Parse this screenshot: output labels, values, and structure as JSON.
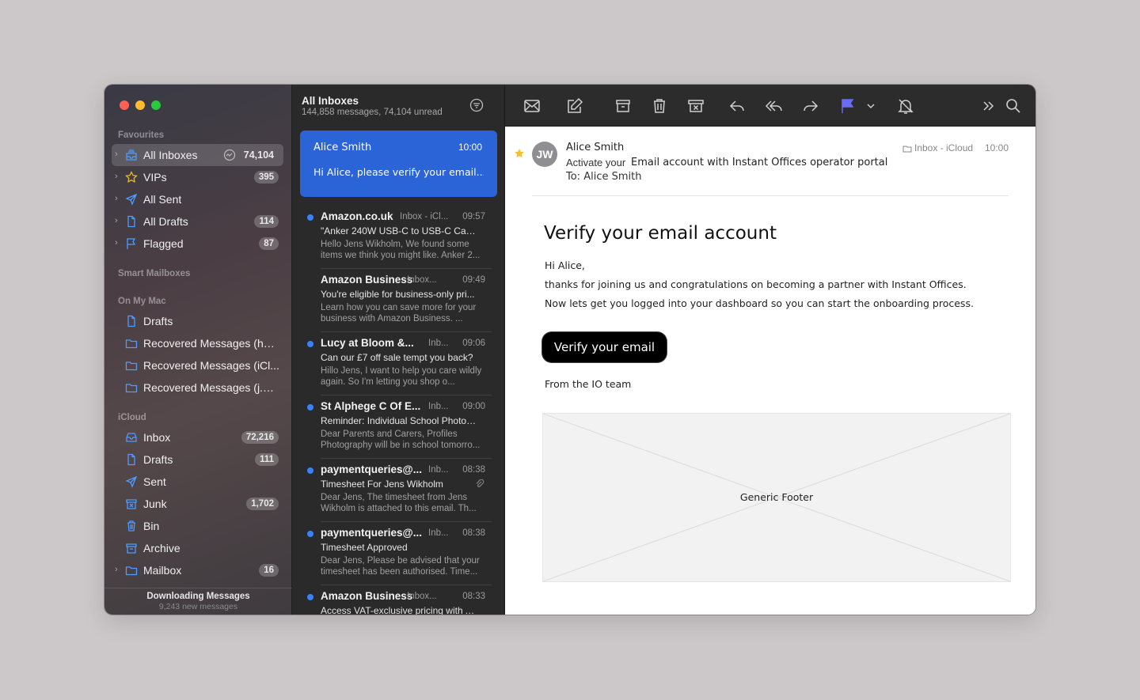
{
  "sidebar": {
    "sections": {
      "favourites": "Favourites",
      "smart": "Smart Mailboxes",
      "mac": "On My Mac",
      "icloud": "iCloud"
    },
    "favourites": [
      {
        "label": "All Inboxes",
        "count": "74,104"
      },
      {
        "label": "VIPs",
        "count": "395"
      },
      {
        "label": "All Sent",
        "count": ""
      },
      {
        "label": "All Drafts",
        "count": "114"
      },
      {
        "label": "Flagged",
        "count": "87"
      }
    ],
    "mac": [
      {
        "label": "Drafts"
      },
      {
        "label": "Recovered Messages (hell..."
      },
      {
        "label": "Recovered Messages (iCl..."
      },
      {
        "label": "Recovered Messages (j.wi..."
      }
    ],
    "icloud": [
      {
        "label": "Inbox",
        "count": "72,216"
      },
      {
        "label": "Drafts",
        "count": "111"
      },
      {
        "label": "Sent",
        "count": ""
      },
      {
        "label": "Junk",
        "count": "1,702"
      },
      {
        "label": "Bin",
        "count": ""
      },
      {
        "label": "Archive",
        "count": ""
      },
      {
        "label": "Mailbox",
        "count": "16"
      }
    ],
    "footer": {
      "title": "Downloading Messages",
      "sub": "9,243 new messages"
    }
  },
  "list": {
    "title": "All Inboxes",
    "subtitle": "144,858 messages, 74,104 unread",
    "selected": {
      "from": "Alice Smith",
      "time": "10:00",
      "subject": "Hi Alice, please verify your email..."
    },
    "messages": [
      {
        "from": "Amazon.co.uk",
        "mailbox": "Inbox - iCl...",
        "time": "09:57",
        "subject": "\"Anker 240W USB-C to USB-C Cabl...",
        "preview": "Hello Jens Wikholm, We found some items we think you might like. Anker 2..."
      },
      {
        "from": "Amazon Business",
        "mailbox": "Inbox...",
        "time": "09:49",
        "subject": "You're eligible for business-only pri...",
        "preview": "Learn how you can save more for your business with Amazon Business. ..."
      },
      {
        "from": "Lucy at Bloom &...",
        "mailbox": "Inb...",
        "time": "09:06",
        "subject": "Can our £7 off sale tempt you back?",
        "preview": "Hillo Jens, I want to help you care wildly again. So I'm letting you shop o..."
      },
      {
        "from": "St Alphege C Of E...",
        "mailbox": "Inb...",
        "time": "09:00",
        "subject": "Reminder: Individual School Photos...",
        "preview": "Dear Parents and Carers, Profiles Photography will be in school tomorro..."
      },
      {
        "from": "paymentqueries@...",
        "mailbox": "Inb...",
        "time": "08:38",
        "subject": "Timesheet For   Jens Wikholm",
        "preview": "Dear Jens, The timesheet from Jens Wikholm is attached to this email. Th..."
      },
      {
        "from": "paymentqueries@...",
        "mailbox": "Inb...",
        "time": "08:38",
        "subject": "Timesheet Approved",
        "preview": "Dear Jens, Please be advised that your timesheet has been authorised. Time..."
      },
      {
        "from": "Amazon Business",
        "mailbox": "Inbox...",
        "time": "08:33",
        "subject": "Access VAT-exclusive pricing with A...",
        "preview": ""
      }
    ]
  },
  "reader": {
    "avatar": "JW",
    "from": "Alice Smith",
    "subject_prefix": "Activate your",
    "subject": "Email account with Instant Offices operator portal",
    "to": "To: Alice Smith",
    "mailbox": "Inbox - iCloud",
    "time": "10:00",
    "heading": "Verify your email account",
    "greeting": "Hi Alice,",
    "line1": "thanks for joining us and congratulations on becoming a partner with Instant Offices.",
    "line2": "Now lets get you logged into your dashboard so you can start the onboarding process.",
    "button": "Verify your email",
    "signoff": "From the IO team",
    "footer": "Generic Footer"
  },
  "colors": {
    "accent": "#2a64d6",
    "unread": "#3a82f7",
    "flag": "#6a6cf7",
    "star": "#f2c12e"
  }
}
